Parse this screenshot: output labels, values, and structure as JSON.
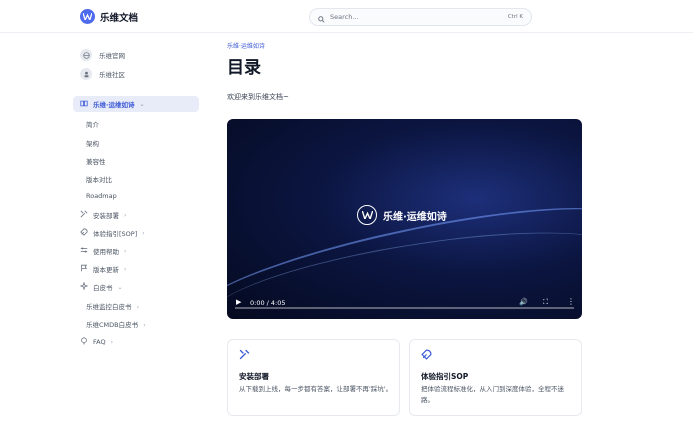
{
  "header": {
    "logo_text": "乐维文档",
    "search_placeholder": "Search...",
    "search_shortcut": "Ctrl K"
  },
  "sidebar": {
    "links": [
      {
        "label": "乐维官网",
        "icon": "globe-icon"
      },
      {
        "label": "乐维社区",
        "icon": "community-icon"
      }
    ],
    "active_group": {
      "label": "乐维·运维如诗",
      "icon": "book-icon"
    },
    "active_children": [
      "简介",
      "架构",
      "兼容性",
      "版本对比",
      "Roadmap"
    ],
    "groups": [
      {
        "label": "安装部署",
        "icon": "tools-icon"
      },
      {
        "label": "体验指引[SOP]",
        "icon": "rocket-icon"
      },
      {
        "label": "使用帮助",
        "icon": "sliders-icon"
      },
      {
        "label": "版本更新",
        "icon": "flag-icon"
      },
      {
        "label": "白皮书",
        "icon": "sparkle-icon"
      }
    ],
    "whitepaper_children": [
      "乐维监控白皮书",
      "乐维CMDB白皮书"
    ],
    "faq": {
      "label": "FAQ",
      "icon": "lightbulb-icon"
    }
  },
  "main": {
    "breadcrumb": "乐维·运维如诗",
    "title": "目录",
    "intro": "欢迎来到乐维文档~",
    "video": {
      "overlay_title": "乐维·运维如诗",
      "time": "0:00 / 4:05",
      "progress_fraction": 0
    },
    "cards": [
      {
        "title": "安装部署",
        "desc": "从下载到上线，每一步都有答案，让部署不再'踩坑'。",
        "icon": "tools-icon"
      },
      {
        "title": "体验指引SOP",
        "desc": "把体验流程标准化，从入门到深度体验，全程不迷路。",
        "icon": "rocket-icon"
      }
    ]
  },
  "colors": {
    "accent": "#3d5ad6",
    "active_bg": "#e8ecf9"
  }
}
